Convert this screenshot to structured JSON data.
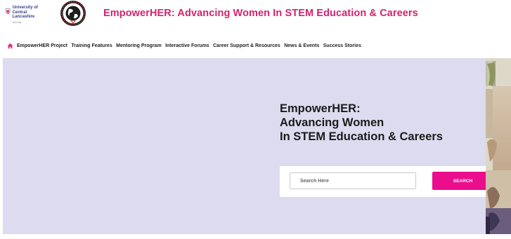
{
  "header": {
    "ucl_logo_text": "University of Central Lancashire",
    "ucl_logo_subtext": "UCLan",
    "site_title": "EmpowerHER: Advancing Women In STEM Education & Careers"
  },
  "nav": {
    "items": [
      {
        "label": "EmpowerHER Project"
      },
      {
        "label": "Training Features"
      },
      {
        "label": "Mentoring Program"
      },
      {
        "label": "Interactive Forums"
      },
      {
        "label": "Career Support & Resources"
      },
      {
        "label": "News & Events"
      },
      {
        "label": "Success Stories"
      }
    ]
  },
  "hero": {
    "title_lines": [
      "EmpowerHER:",
      "Advancing Women",
      "In STEM Education & Careers"
    ]
  },
  "search": {
    "placeholder": "Search Here",
    "button_label": "SEARCH"
  },
  "colors": {
    "brand": "#d4226f",
    "button": "#ea0d8c",
    "hero_bg": "#dcdbef",
    "nav_icon": "#e6317f"
  },
  "icons": {
    "nav_home": "home-icon",
    "ucl_logo": "uclan-crest-icon",
    "partner_logo": "globe-badge-icon"
  }
}
